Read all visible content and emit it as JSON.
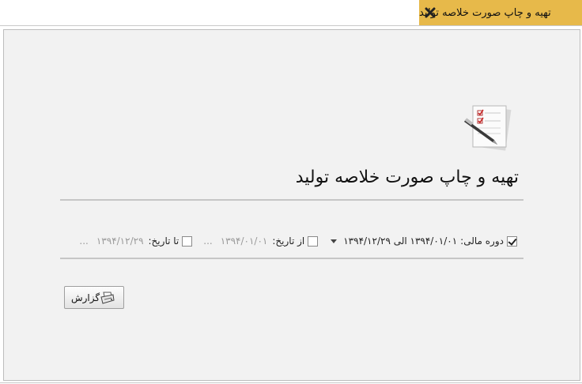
{
  "tab": {
    "title": "تهیه و چاپ صورت خلاصه تولید",
    "close_icon": "close-icon"
  },
  "page": {
    "heading": "تهیه و چاپ صورت خلاصه تولید",
    "icon": "report-checklist-icon"
  },
  "filters": {
    "fiscal_period": {
      "checked": true,
      "label": "دوره مالی:",
      "value": "۱۳۹۴/۰۱/۰۱ الی ۱۳۹۴/۱۲/۲۹"
    },
    "from_date": {
      "checked": false,
      "label": "از تاریخ:",
      "value": "۱۳۹۴/۰۱/۰۱",
      "picker": "..."
    },
    "to_date": {
      "checked": false,
      "label": "تا تاریخ:",
      "value": "۱۳۹۴/۱۲/۲۹",
      "picker": "..."
    }
  },
  "actions": {
    "report_label": "گزارش",
    "report_icon": "printer-icon"
  },
  "colors": {
    "tab_bg": "#e7b94a",
    "panel_bg": "#f2f2f2"
  }
}
